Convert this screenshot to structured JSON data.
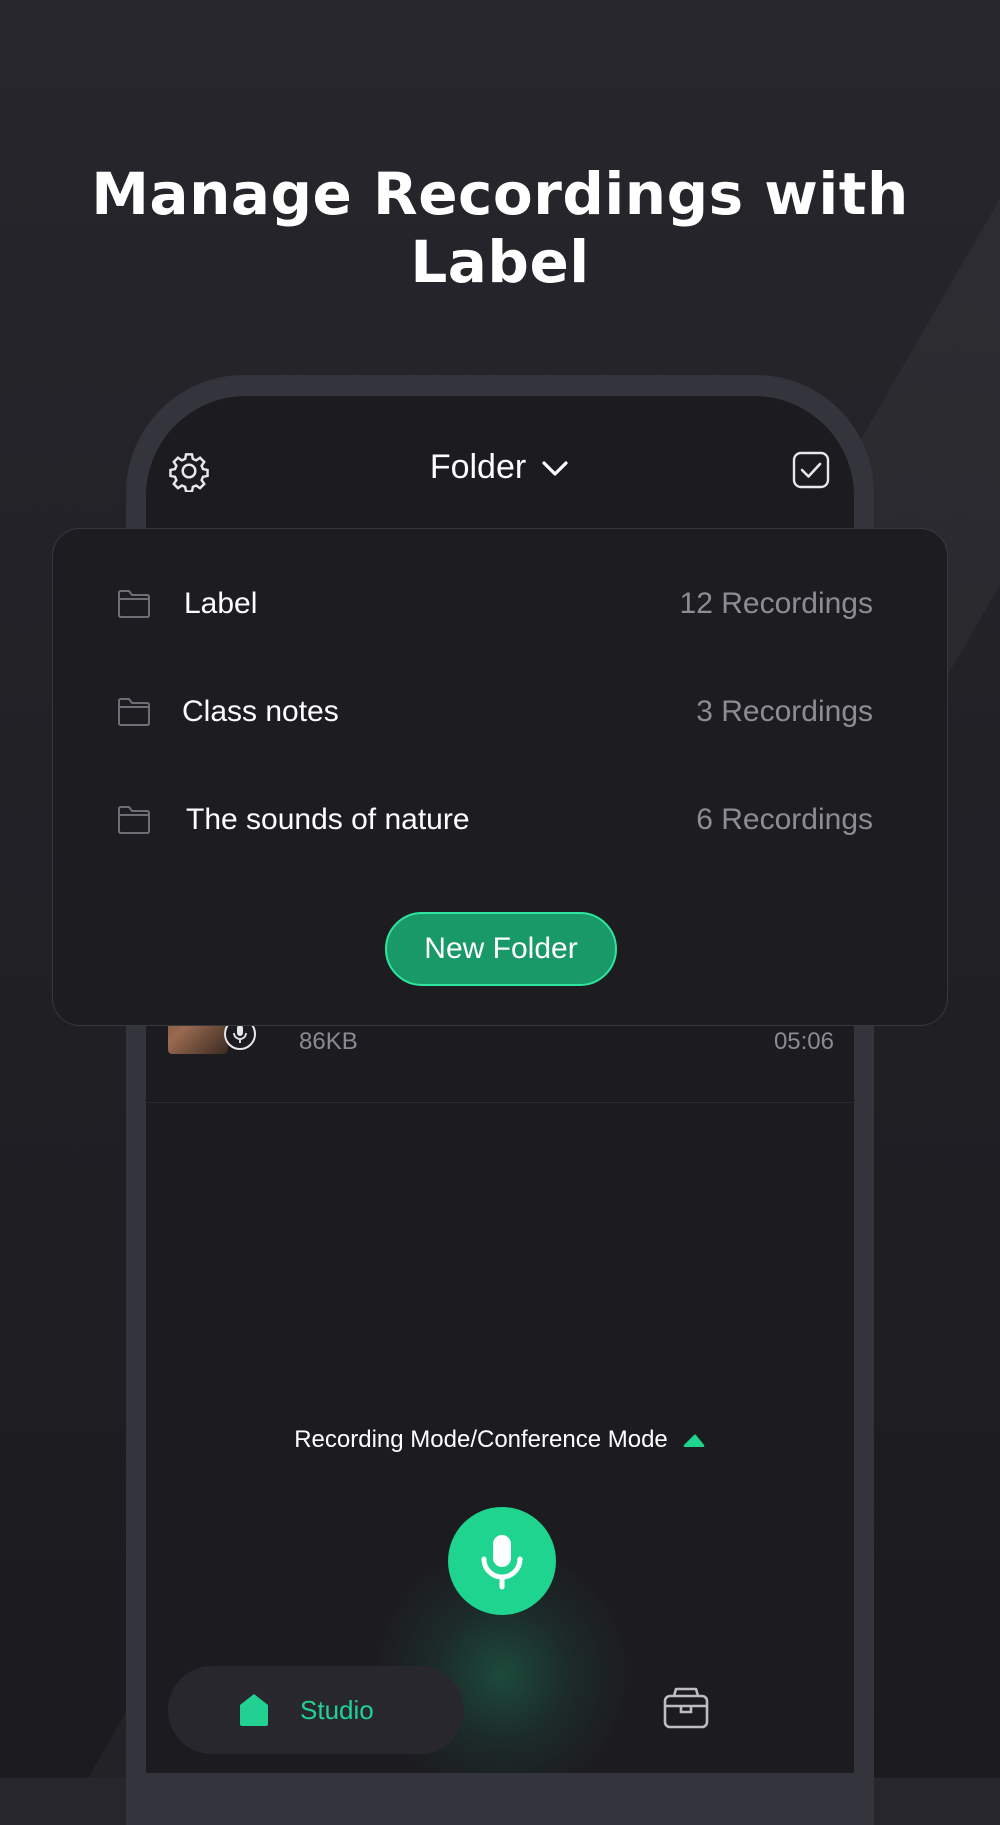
{
  "hero": {
    "title": "Manage Recordings with Label"
  },
  "header": {
    "folder_label": "Folder"
  },
  "dropdown": {
    "items": [
      {
        "name": "Label",
        "count": "12 Recordings"
      },
      {
        "name": "Class notes",
        "count": "3 Recordings"
      },
      {
        "name": "The sounds of nature",
        "count": "6 Recordings"
      }
    ],
    "new_folder_label": "New Folder"
  },
  "recording": {
    "size": "86KB",
    "duration": "05:06"
  },
  "mode": {
    "label": "Recording Mode/Conference Mode"
  },
  "nav": {
    "studio_label": "Studio"
  },
  "colors": {
    "accent": "#1fd48f",
    "background": "#1c1c20",
    "frame": "#34343c"
  },
  "icons": [
    "gear-icon",
    "chevron-down-icon",
    "checkbox-icon",
    "folder-icon",
    "mic-icon",
    "triangle-up-icon",
    "home-icon",
    "toolbox-icon"
  ]
}
